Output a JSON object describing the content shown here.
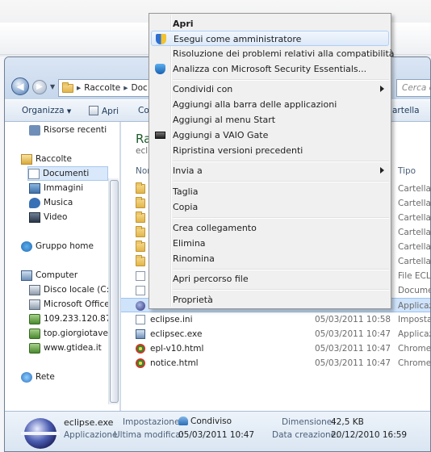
{
  "window": {
    "address": {
      "segment1": "Raccolte",
      "segment2": "Doc"
    },
    "search_placeholder": "Cerca ec"
  },
  "toolbar": {
    "organize": "Organizza",
    "open": "Apri",
    "co_partial": "Co",
    "folder_partial": "artella"
  },
  "sidebar": {
    "recent": "Risorse recenti",
    "libraries": "Raccolte",
    "documents": "Documenti",
    "images": "Immagini",
    "music": "Musica",
    "video": "Video",
    "homegroup": "Gruppo home",
    "computer": "Computer",
    "local_disk": "Disco locale (C:)",
    "ms_office": "Microsoft Office",
    "ip": "109.233.120.87",
    "giorgiotave": "top.giorgiotave.it",
    "gtidea": "www.gtidea.it",
    "network": "Rete"
  },
  "content": {
    "heading_partial": "Rac",
    "subheading_partial": "eclip",
    "col_name_partial": "Nom",
    "col_type": "Tipo",
    "partial_rows": [
      {
        "name": "c",
        "type": "Cartella di"
      },
      {
        "name": "c",
        "type": "Cartella di"
      },
      {
        "name": "f",
        "type": "Cartella di"
      },
      {
        "name": "p",
        "type": "Cartella di"
      },
      {
        "name": "p",
        "type": "Cartella di"
      },
      {
        "name": "r",
        "type": "Cartella di"
      },
      {
        "name": ".e",
        "type": "File ECLIPS"
      },
      {
        "name": "a",
        "type": "Document"
      },
      {
        "name": "e",
        "type": "Applicazio"
      }
    ],
    "files": [
      {
        "name": "eclipse.ini",
        "date": "05/03/2011 10:58",
        "type": "Impostazio"
      },
      {
        "name": "eclipsec.exe",
        "date": "05/03/2011 10:47",
        "type": "Applicazio"
      },
      {
        "name": "epl-v10.html",
        "date": "05/03/2011 10:47",
        "type": "Chrome H"
      },
      {
        "name": "notice.html",
        "date": "05/03/2011 10:47",
        "type": "Chrome H"
      }
    ]
  },
  "details": {
    "filename": "eclipse.exe",
    "type": "Applicazione",
    "settings_label": "Impostazione:",
    "settings_value": "Condiviso",
    "modified_label": "Ultima modifica:",
    "modified_value": "05/03/2011 10:47",
    "size_label": "Dimensione:",
    "size_value": "42,5 KB",
    "created_label": "Data creazione:",
    "created_value": "20/12/2010 16:59"
  },
  "context_menu": {
    "open": "Apri",
    "run_as_admin": "Esegui come amministratore",
    "compat": "Risoluzione dei problemi relativi alla compatibilità",
    "mse": "Analizza con Microsoft Security Essentials...",
    "share": "Condividi con",
    "pin_taskbar": "Aggiungi alla barra delle applicazioni",
    "pin_start": "Aggiungi al menu Start",
    "vaio": "Aggiungi a VAIO Gate",
    "restore": "Ripristina versioni precedenti",
    "send_to": "Invia a",
    "cut": "Taglia",
    "copy": "Copia",
    "shortcut": "Crea collegamento",
    "delete": "Elimina",
    "rename": "Rinomina",
    "open_location": "Apri percorso file",
    "properties": "Proprietà"
  }
}
